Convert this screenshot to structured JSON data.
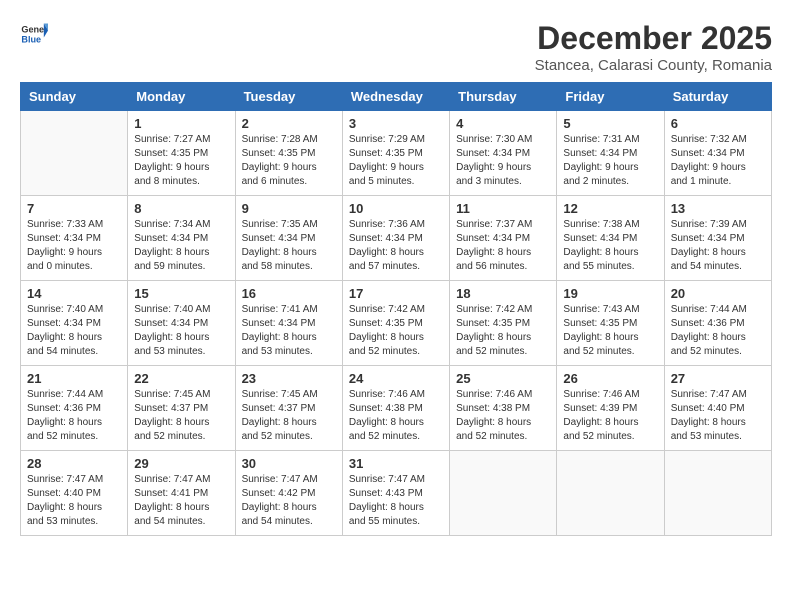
{
  "logo": {
    "general": "General",
    "blue": "Blue"
  },
  "title": "December 2025",
  "subtitle": "Stancea, Calarasi County, Romania",
  "headers": [
    "Sunday",
    "Monday",
    "Tuesday",
    "Wednesday",
    "Thursday",
    "Friday",
    "Saturday"
  ],
  "weeks": [
    [
      {
        "day": "",
        "info": ""
      },
      {
        "day": "1",
        "info": "Sunrise: 7:27 AM\nSunset: 4:35 PM\nDaylight: 9 hours\nand 8 minutes."
      },
      {
        "day": "2",
        "info": "Sunrise: 7:28 AM\nSunset: 4:35 PM\nDaylight: 9 hours\nand 6 minutes."
      },
      {
        "day": "3",
        "info": "Sunrise: 7:29 AM\nSunset: 4:35 PM\nDaylight: 9 hours\nand 5 minutes."
      },
      {
        "day": "4",
        "info": "Sunrise: 7:30 AM\nSunset: 4:34 PM\nDaylight: 9 hours\nand 3 minutes."
      },
      {
        "day": "5",
        "info": "Sunrise: 7:31 AM\nSunset: 4:34 PM\nDaylight: 9 hours\nand 2 minutes."
      },
      {
        "day": "6",
        "info": "Sunrise: 7:32 AM\nSunset: 4:34 PM\nDaylight: 9 hours\nand 1 minute."
      }
    ],
    [
      {
        "day": "7",
        "info": "Sunrise: 7:33 AM\nSunset: 4:34 PM\nDaylight: 9 hours\nand 0 minutes."
      },
      {
        "day": "8",
        "info": "Sunrise: 7:34 AM\nSunset: 4:34 PM\nDaylight: 8 hours\nand 59 minutes."
      },
      {
        "day": "9",
        "info": "Sunrise: 7:35 AM\nSunset: 4:34 PM\nDaylight: 8 hours\nand 58 minutes."
      },
      {
        "day": "10",
        "info": "Sunrise: 7:36 AM\nSunset: 4:34 PM\nDaylight: 8 hours\nand 57 minutes."
      },
      {
        "day": "11",
        "info": "Sunrise: 7:37 AM\nSunset: 4:34 PM\nDaylight: 8 hours\nand 56 minutes."
      },
      {
        "day": "12",
        "info": "Sunrise: 7:38 AM\nSunset: 4:34 PM\nDaylight: 8 hours\nand 55 minutes."
      },
      {
        "day": "13",
        "info": "Sunrise: 7:39 AM\nSunset: 4:34 PM\nDaylight: 8 hours\nand 54 minutes."
      }
    ],
    [
      {
        "day": "14",
        "info": "Sunrise: 7:40 AM\nSunset: 4:34 PM\nDaylight: 8 hours\nand 54 minutes."
      },
      {
        "day": "15",
        "info": "Sunrise: 7:40 AM\nSunset: 4:34 PM\nDaylight: 8 hours\nand 53 minutes."
      },
      {
        "day": "16",
        "info": "Sunrise: 7:41 AM\nSunset: 4:34 PM\nDaylight: 8 hours\nand 53 minutes."
      },
      {
        "day": "17",
        "info": "Sunrise: 7:42 AM\nSunset: 4:35 PM\nDaylight: 8 hours\nand 52 minutes."
      },
      {
        "day": "18",
        "info": "Sunrise: 7:42 AM\nSunset: 4:35 PM\nDaylight: 8 hours\nand 52 minutes."
      },
      {
        "day": "19",
        "info": "Sunrise: 7:43 AM\nSunset: 4:35 PM\nDaylight: 8 hours\nand 52 minutes."
      },
      {
        "day": "20",
        "info": "Sunrise: 7:44 AM\nSunset: 4:36 PM\nDaylight: 8 hours\nand 52 minutes."
      }
    ],
    [
      {
        "day": "21",
        "info": "Sunrise: 7:44 AM\nSunset: 4:36 PM\nDaylight: 8 hours\nand 52 minutes."
      },
      {
        "day": "22",
        "info": "Sunrise: 7:45 AM\nSunset: 4:37 PM\nDaylight: 8 hours\nand 52 minutes."
      },
      {
        "day": "23",
        "info": "Sunrise: 7:45 AM\nSunset: 4:37 PM\nDaylight: 8 hours\nand 52 minutes."
      },
      {
        "day": "24",
        "info": "Sunrise: 7:46 AM\nSunset: 4:38 PM\nDaylight: 8 hours\nand 52 minutes."
      },
      {
        "day": "25",
        "info": "Sunrise: 7:46 AM\nSunset: 4:38 PM\nDaylight: 8 hours\nand 52 minutes."
      },
      {
        "day": "26",
        "info": "Sunrise: 7:46 AM\nSunset: 4:39 PM\nDaylight: 8 hours\nand 52 minutes."
      },
      {
        "day": "27",
        "info": "Sunrise: 7:47 AM\nSunset: 4:40 PM\nDaylight: 8 hours\nand 53 minutes."
      }
    ],
    [
      {
        "day": "28",
        "info": "Sunrise: 7:47 AM\nSunset: 4:40 PM\nDaylight: 8 hours\nand 53 minutes."
      },
      {
        "day": "29",
        "info": "Sunrise: 7:47 AM\nSunset: 4:41 PM\nDaylight: 8 hours\nand 54 minutes."
      },
      {
        "day": "30",
        "info": "Sunrise: 7:47 AM\nSunset: 4:42 PM\nDaylight: 8 hours\nand 54 minutes."
      },
      {
        "day": "31",
        "info": "Sunrise: 7:47 AM\nSunset: 4:43 PM\nDaylight: 8 hours\nand 55 minutes."
      },
      {
        "day": "",
        "info": ""
      },
      {
        "day": "",
        "info": ""
      },
      {
        "day": "",
        "info": ""
      }
    ]
  ]
}
